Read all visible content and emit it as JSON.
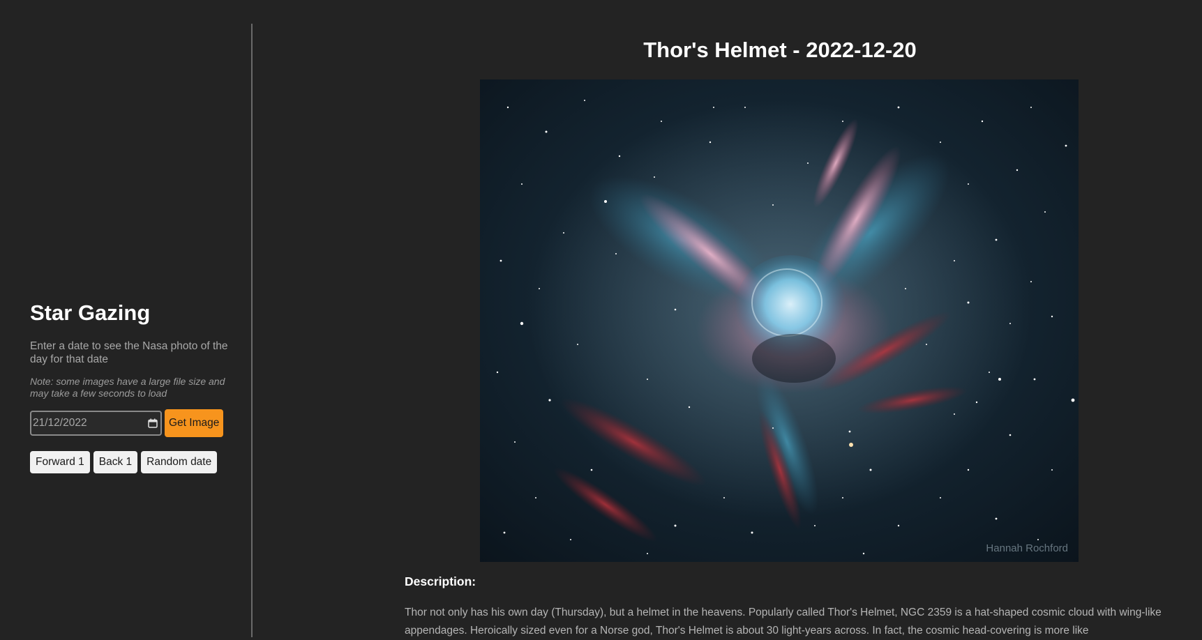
{
  "sidebar": {
    "title": "Star Gazing",
    "description": "Enter a date to see the Nasa photo of the day for that date",
    "note": "Note: some images have a large file size and may take a few seconds to load",
    "date_value": "21/12/2022",
    "get_image_label": "Get Image",
    "forward_label": "Forward 1",
    "back_label": "Back 1",
    "random_label": "Random date"
  },
  "main": {
    "title": "Thor's Helmet - 2022-12-20",
    "image_credit": "Hannah Rochford",
    "description_label": "Description:",
    "description_text": "Thor not only has his own day (Thursday), but a helmet in the heavens. Popularly called Thor's Helmet, NGC 2359 is a hat-shaped cosmic cloud with wing-like appendages. Heroically sized even for a Norse god, Thor's Helmet is about 30 light-years across. In fact, the cosmic head-covering is more like"
  },
  "colors": {
    "background": "#232323",
    "accent": "#f7941d",
    "button_light": "#f1f1f1",
    "divider": "#6a6a6a"
  },
  "icons": {
    "date_picker": "calendar-icon"
  }
}
